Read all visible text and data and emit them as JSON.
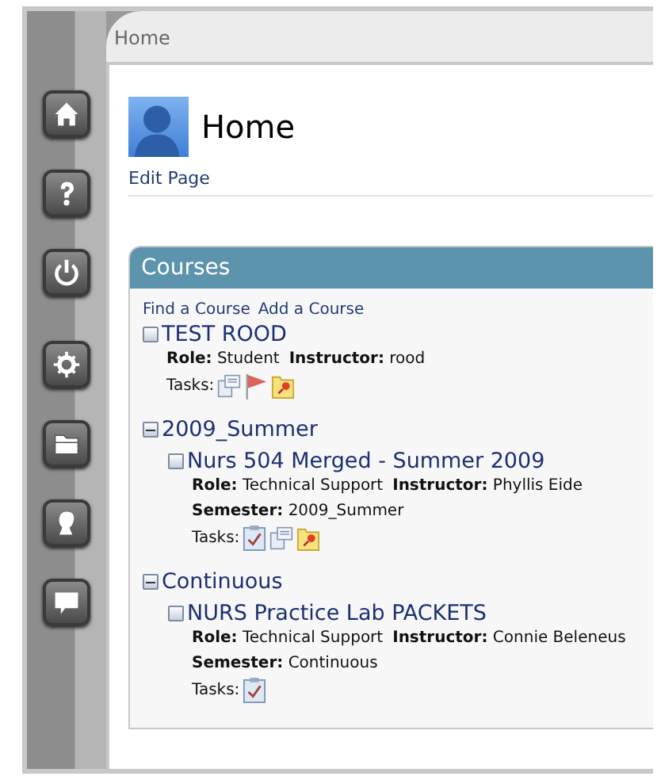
{
  "breadcrumb": "Home",
  "sidebar": {
    "items": [
      {
        "kind": "home"
      },
      {
        "kind": "help"
      },
      {
        "kind": "power"
      },
      {
        "kind": "gear"
      },
      {
        "kind": "folder"
      },
      {
        "kind": "bust"
      },
      {
        "kind": "chat"
      }
    ]
  },
  "page": {
    "title": "Home",
    "edit_link": "Edit Page"
  },
  "courses": {
    "title": "Courses",
    "links": [
      "Find a Course",
      "Add a Course"
    ],
    "items": [
      {
        "kind": "course",
        "name": "TEST ROOD",
        "details": [
          [
            {
              "label": "Role:",
              "value": "Student"
            },
            {
              "label": "Instructor:",
              "value": "rood"
            }
          ]
        ],
        "tasks_label": "Tasks:",
        "tasks": [
          {
            "kind": "document"
          },
          {
            "kind": "flag"
          },
          {
            "kind": "pin"
          }
        ]
      },
      {
        "kind": "group",
        "name": "2009_Summer",
        "expanded": true,
        "children": [
          {
            "kind": "course",
            "name": "Nurs 504 Merged - Summer 2009",
            "details": [
              [
                {
                  "label": "Role:",
                  "value": "Technical Support"
                },
                {
                  "label": "Instructor:",
                  "value": "Phyllis Eide"
                }
              ],
              [
                {
                  "label": "Semester:",
                  "value": "2009_Summer"
                }
              ]
            ],
            "tasks_label": "Tasks:",
            "tasks": [
              {
                "kind": "check"
              },
              {
                "kind": "document"
              },
              {
                "kind": "pin"
              }
            ]
          }
        ]
      },
      {
        "kind": "group",
        "name": "Continuous",
        "expanded": true,
        "children": [
          {
            "kind": "course",
            "name": "NURS Practice Lab PACKETS",
            "details": [
              [
                {
                  "label": "Role:",
                  "value": "Technical Support"
                },
                {
                  "label": "Instructor:",
                  "value": "Connie Beleneus"
                }
              ],
              [
                {
                  "label": "Semester:",
                  "value": "Continuous"
                }
              ]
            ],
            "tasks_label": "Tasks:",
            "tasks": [
              {
                "kind": "check"
              }
            ]
          }
        ]
      }
    ]
  }
}
